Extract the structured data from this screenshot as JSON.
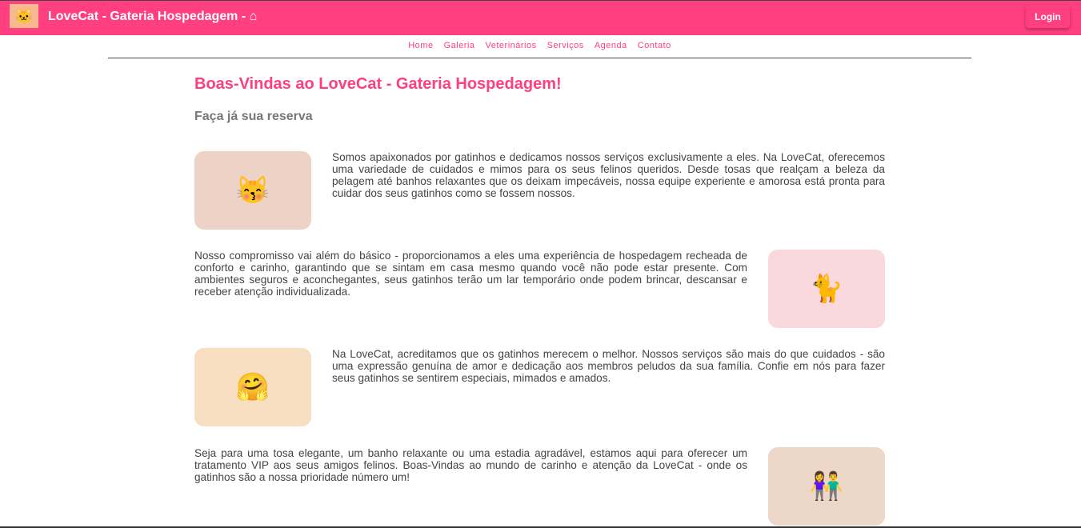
{
  "header": {
    "title": "LoveCat - Gateria Hospedagem - ",
    "home_icon": "home-icon",
    "login": "Login"
  },
  "nav": [
    "Home",
    "Galeria",
    "Veterinários",
    "Serviços",
    "Agenda",
    "Contato"
  ],
  "main": {
    "heading": "Boas-Vindas ao LoveCat - Gateria Hospedagem!",
    "subheading": "Faça já sua reserva",
    "sections": [
      {
        "text": "Somos apaixonados por gatinhos e dedicamos nossos serviços exclusivamente a eles. Na LoveCat, oferecemos uma variedade de cuidados e mimos para os seus felinos queridos. Desde tosas que realçam a beleza da pelagem até banhos relaxantes que os deixam impecáveis, nossa equipe experiente e amorosa está pronta para cuidar dos seus gatinhos como se fossem nossos.",
        "bg": "#ecd3c5"
      },
      {
        "text": "Nosso compromisso vai além do básico - proporcionamos a eles uma experiência de hospedagem recheada de conforto e carinho, garantindo que se sintam em casa mesmo quando você não pode estar presente. Com ambientes seguros e aconchegantes, seus gatinhos terão um lar temporário onde podem brincar, descansar e receber atenção individualizada.",
        "bg": "#f9d9de"
      },
      {
        "text": "Na LoveCat, acreditamos que os gatinhos merecem o melhor. Nossos serviços são mais do que cuidados - são uma expressão genuína de amor e dedicação aos membros peludos da sua família. Confie em nós para fazer seus gatinhos se sentirem especiais, mimados e amados.",
        "bg": "#f8dfc2"
      },
      {
        "text": "Seja para uma tosa elegante, um banho relaxante ou uma estadia agradável, estamos aqui para oferecer um tratamento VIP aos seus amigos felinos. Boas-Vindas ao mundo de carinho e atenção da LoveCat - onde os gatinhos são a nossa prioridade número um!",
        "bg": "#ecd7c9"
      }
    ]
  }
}
